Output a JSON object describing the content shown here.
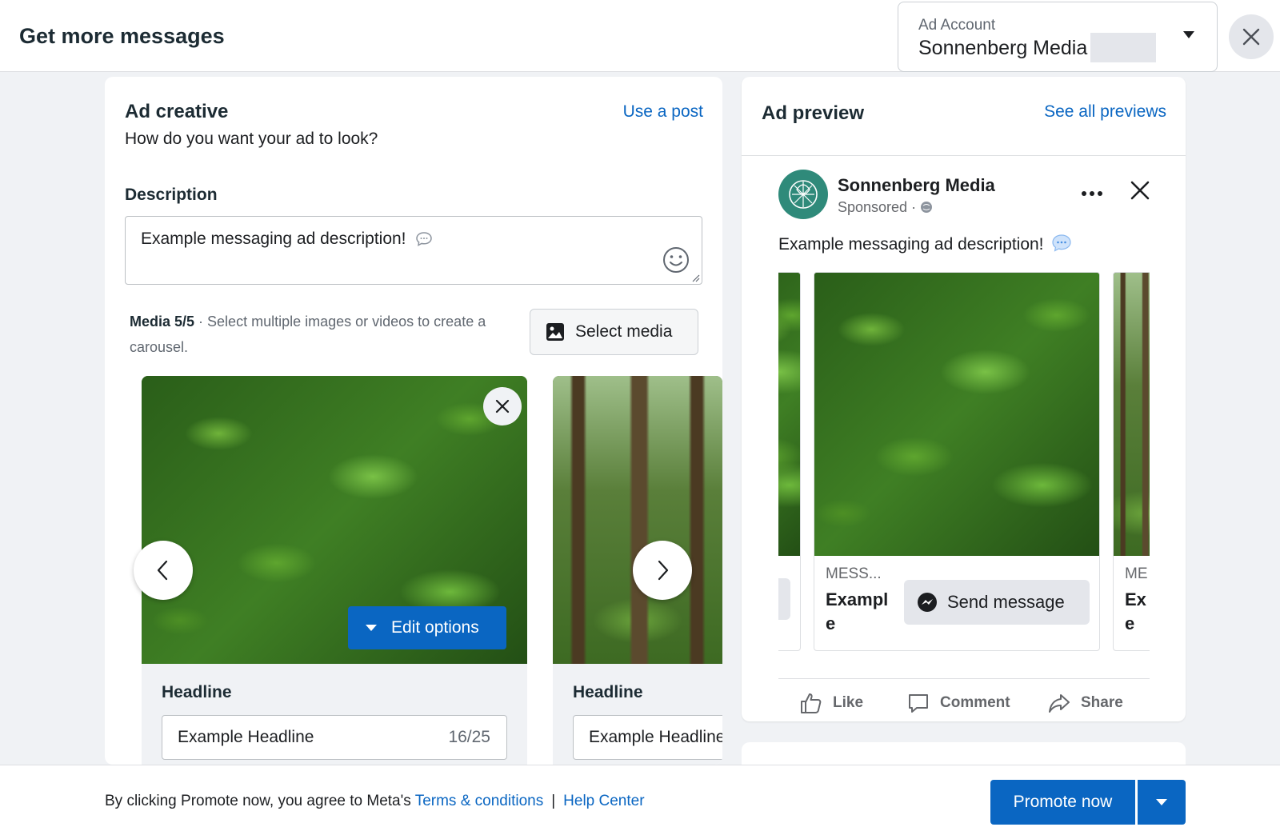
{
  "header": {
    "title": "Get more messages",
    "account_label": "Ad Account",
    "account_value": "Sonnenberg Media"
  },
  "creative": {
    "title": "Ad creative",
    "use_post_link": "Use a post",
    "subtitle": "How do you want your ad to look?",
    "description_label": "Description",
    "description_value": "Example messaging ad description!",
    "media_count": "Media 5/5",
    "media_hint": " · Select multiple images or videos to create a carousel.",
    "select_media_label": "Select media",
    "edit_options_label": "Edit options",
    "cards": [
      {
        "headline_label": "Headline",
        "headline_value": "Example Headline",
        "counter": "16/25"
      },
      {
        "headline_label": "Headline",
        "headline_value": "Example Headline"
      }
    ]
  },
  "preview": {
    "title": "Ad preview",
    "see_all_link": "See all previews",
    "page_name": "Sonnenberg Media",
    "sponsored": "Sponsored · ",
    "post_text": "Example messaging ad description!",
    "carousel": {
      "left_card": {
        "sub": "",
        "title": ""
      },
      "main_card": {
        "sub": "MESS...",
        "title": "Exampl e",
        "cta": "Send message"
      },
      "right_card": {
        "sub": "ME",
        "title": "Ex e"
      }
    },
    "actions": {
      "like": "Like",
      "comment": "Comment",
      "share": "Share"
    }
  },
  "footer": {
    "agreement_text": "By clicking Promote now, you agree to Meta's ",
    "terms_link": "Terms & conditions",
    "separator": "|",
    "help_link": "Help Center",
    "promote_button": "Promote now"
  },
  "colors": {
    "accent": "#0a66c2",
    "background": "#f0f2f5",
    "avatar": "#2f8a7a"
  }
}
